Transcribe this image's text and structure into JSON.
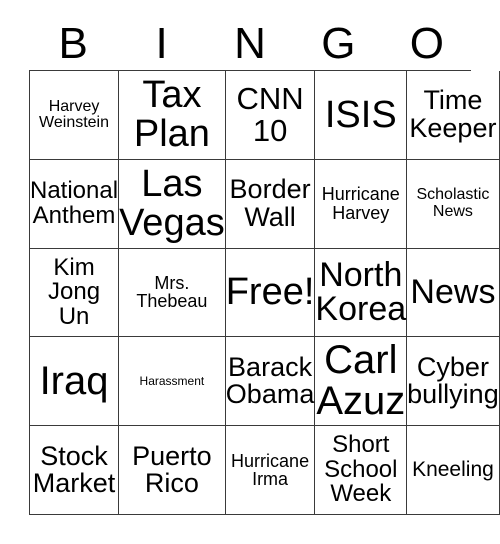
{
  "card": {
    "header_letters": [
      "B",
      "I",
      "N",
      "G",
      "O"
    ],
    "rows": [
      [
        {
          "text": "Harvey\nWeinstein",
          "size": "fs-s"
        },
        {
          "text": "Tax\nPlan",
          "size": "fs-3xl"
        },
        {
          "text": "CNN\n10",
          "size": "fs-xl"
        },
        {
          "text": "ISIS",
          "size": "fs-3xl"
        },
        {
          "text": "Time\nKeeper",
          "size": "fs-l"
        }
      ],
      [
        {
          "text": "National\nAnthem",
          "size": "fs-ml"
        },
        {
          "text": "Las\nVegas",
          "size": "fs-3xl"
        },
        {
          "text": "Border\nWall",
          "size": "fs-l"
        },
        {
          "text": "Hurricane\nHarvey",
          "size": "fs-ms"
        },
        {
          "text": "Scholastic\nNews",
          "size": "fs-s"
        }
      ],
      [
        {
          "text": "Kim\nJong\nUn",
          "size": "fs-ml"
        },
        {
          "text": "Mrs.\nThebeau",
          "size": "fs-ms"
        },
        {
          "text": "Free!",
          "size": "fs-3xl"
        },
        {
          "text": "North\nKorea",
          "size": "fs-xxl"
        },
        {
          "text": "News",
          "size": "fs-xxl"
        }
      ],
      [
        {
          "text": "Iraq",
          "size": "fs-4xl"
        },
        {
          "text": "Harassment",
          "size": "fs-xs"
        },
        {
          "text": "Barack\nObama",
          "size": "fs-l"
        },
        {
          "text": "Carl\nAzuz",
          "size": "fs-4xl"
        },
        {
          "text": "Cyber\nbullying",
          "size": "fs-l"
        }
      ],
      [
        {
          "text": "Stock\nMarket",
          "size": "fs-l"
        },
        {
          "text": "Puerto\nRico",
          "size": "fs-l"
        },
        {
          "text": "Hurricane\nIrma",
          "size": "fs-ms"
        },
        {
          "text": "Short\nSchool\nWeek",
          "size": "fs-ml"
        },
        {
          "text": "Kneeling",
          "size": "fs-m"
        }
      ]
    ],
    "free_space": {
      "row": 2,
      "col": 2,
      "label": "Free!"
    },
    "colors": {
      "background": "#ffffff",
      "text": "#000000",
      "grid_line": "#3a3a3a"
    }
  }
}
